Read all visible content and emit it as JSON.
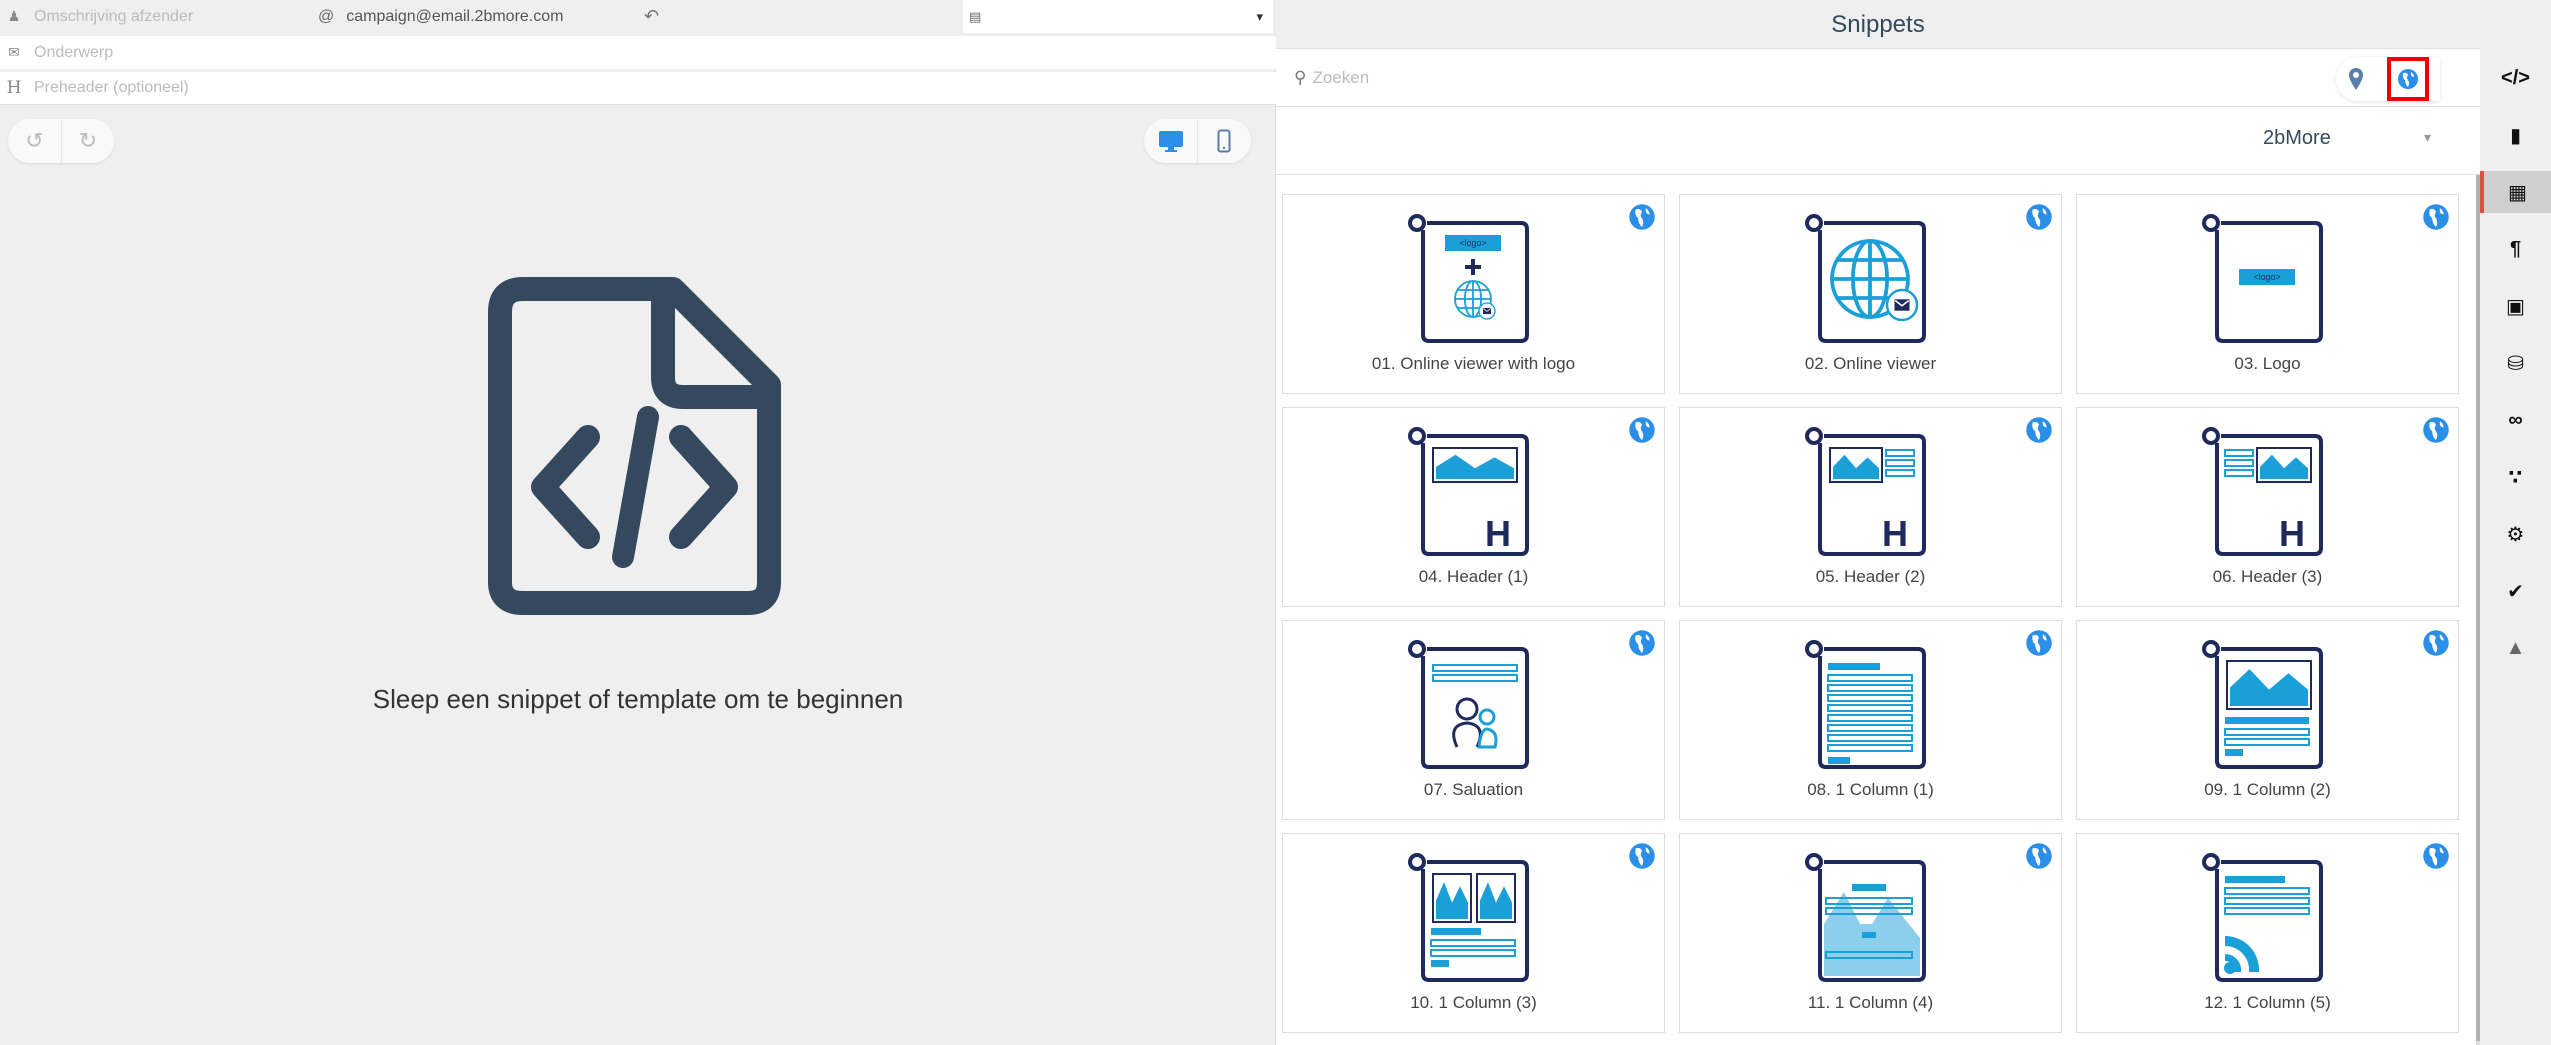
{
  "header": {
    "sender_placeholder": "Omschrijving afzender",
    "email_at": "@",
    "email": "campaign@email.2bmore.com",
    "subject_placeholder": "Onderwerp",
    "preheader_placeholder": "Preheader (optioneel)",
    "select_caret": "▾"
  },
  "canvas": {
    "empty_message": "Sleep een snippet of template om te beginnen"
  },
  "snippets": {
    "title": "Snippets",
    "search_placeholder": "Zoeken",
    "filter_value": "2bMore",
    "filter_caret": "▾",
    "items": [
      {
        "label": "01. Online viewer with logo",
        "thumbnail": "logo-plus-globe"
      },
      {
        "label": "02. Online viewer",
        "thumbnail": "globe-mail"
      },
      {
        "label": "03. Logo",
        "thumbnail": "logo"
      },
      {
        "label": "04. Header (1)",
        "thumbnail": "header-1"
      },
      {
        "label": "05. Header (2)",
        "thumbnail": "header-2"
      },
      {
        "label": "06. Header (3)",
        "thumbnail": "header-3"
      },
      {
        "label": "07. Saluation",
        "thumbnail": "saluation"
      },
      {
        "label": "08. 1 Column (1)",
        "thumbnail": "column-1"
      },
      {
        "label": "09. 1 Column (2)",
        "thumbnail": "column-2"
      },
      {
        "label": "10. 1 Column (3)",
        "thumbnail": "column-3"
      },
      {
        "label": "11. 1 Column (4)",
        "thumbnail": "column-4"
      },
      {
        "label": "12. 1 Column (5)",
        "thumbnail": "column-5"
      }
    ]
  },
  "sidebar": [
    "code",
    "page",
    "snippets",
    "paragraph",
    "image",
    "database",
    "link",
    "rss",
    "settings",
    "check",
    "flask"
  ],
  "colors": {
    "navy": "#1f2a5c",
    "blue": "#1a9fd9",
    "globe": "#2b8fe8",
    "active": "#e05040"
  }
}
